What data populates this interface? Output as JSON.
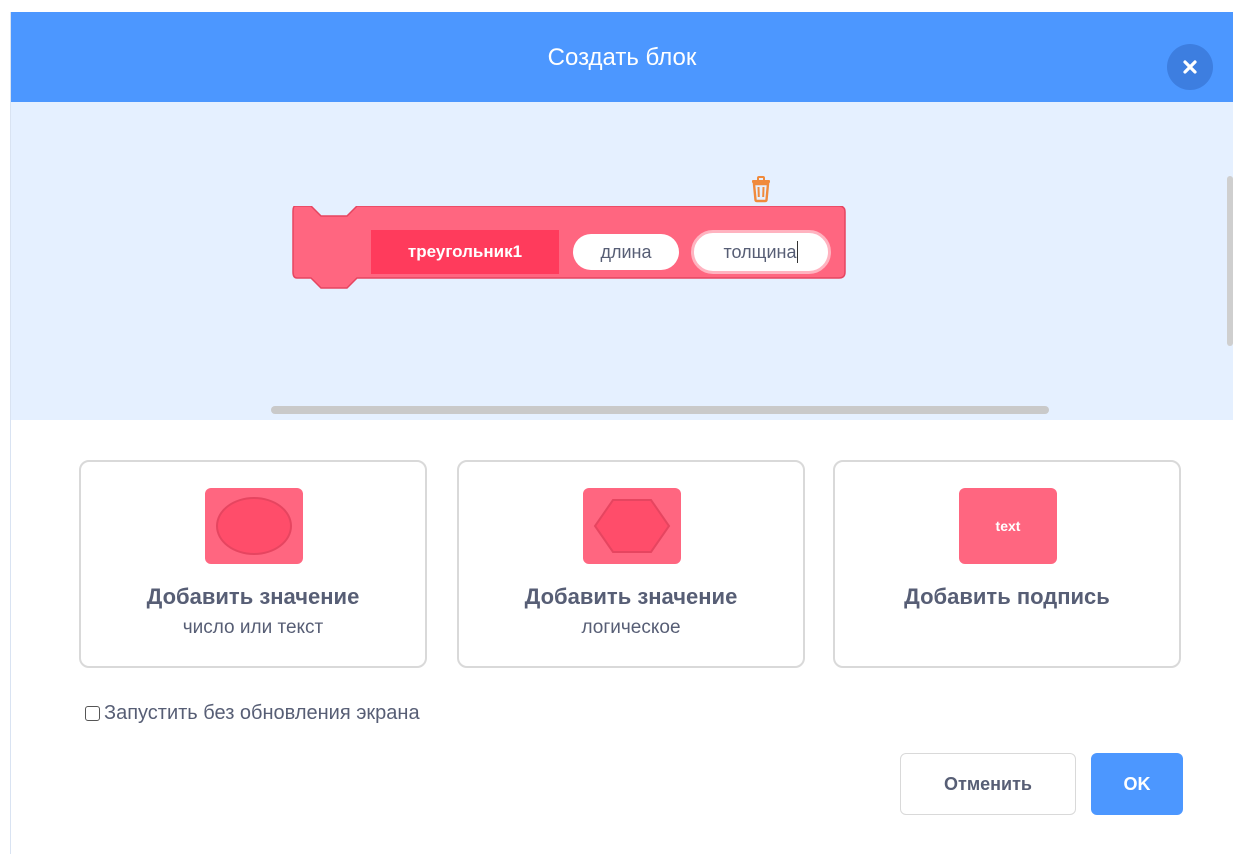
{
  "dialog": {
    "title": "Создать блок",
    "close_icon": "close-icon",
    "header_color": "#4c97ff"
  },
  "preview": {
    "block_name": "треугольник1",
    "inputs": [
      "длина",
      "толщина"
    ],
    "block_color": "#ff6680",
    "delete_icon": "trash-icon"
  },
  "options": [
    {
      "title": "Добавить значение",
      "subtitle": "число или текст",
      "icon": "oval-input-icon"
    },
    {
      "title": "Добавить значение",
      "subtitle": "логическое",
      "icon": "boolean-input-icon"
    },
    {
      "title": "Добавить подпись",
      "subtitle": "",
      "icon": "text-label-icon",
      "icon_text": "text"
    }
  ],
  "run_without_refresh": {
    "label": "Запустить без обновления экрана",
    "checked": false
  },
  "buttons": {
    "cancel": "Отменить",
    "ok": "OK"
  }
}
